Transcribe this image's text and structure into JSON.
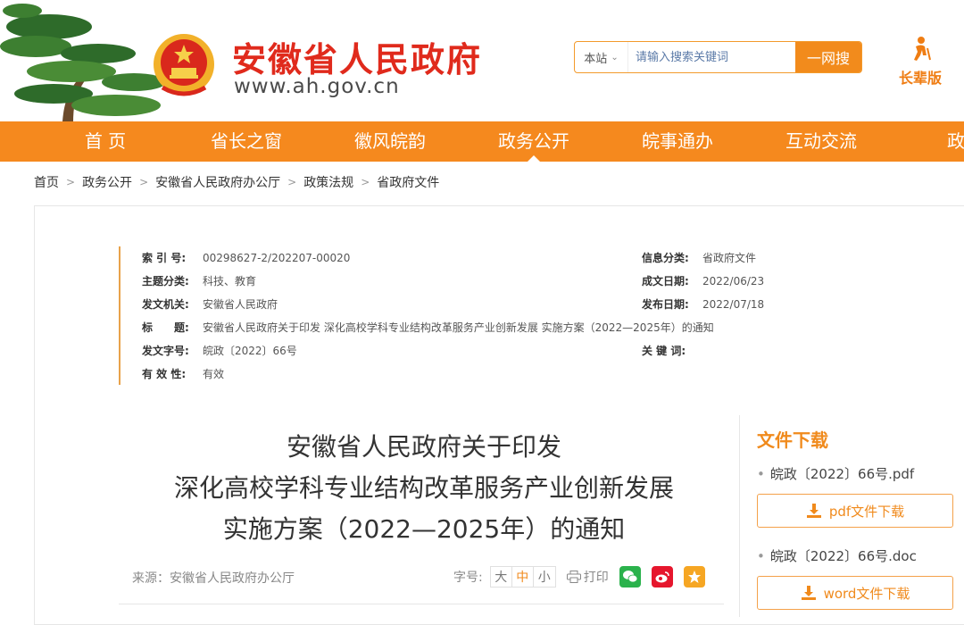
{
  "header": {
    "site_title": "安徽省人民政府",
    "site_url": "www.ah.gov.cn",
    "search": {
      "scope": "本站",
      "placeholder": "请输入搜索关键词",
      "button": "一网搜"
    },
    "elder_mode": "长辈版"
  },
  "nav": {
    "items": [
      {
        "label": "首 页",
        "active": false
      },
      {
        "label": "省长之窗",
        "active": false
      },
      {
        "label": "徽风皖韵",
        "active": false
      },
      {
        "label": "政务公开",
        "active": true
      },
      {
        "label": "皖事通办",
        "active": false
      },
      {
        "label": "互动交流",
        "active": false
      },
      {
        "label": "政府",
        "active": false
      }
    ]
  },
  "breadcrumb": [
    "首页",
    "政务公开",
    "安徽省人民政府办公厅",
    "政策法规",
    "省政府文件"
  ],
  "meta": {
    "index_no": {
      "k": "索 引 号:",
      "v": "00298627-2/202207-00020"
    },
    "topic": {
      "k": "主题分类:",
      "v": "科技、教育"
    },
    "issuer": {
      "k": "发文机关:",
      "v": "安徽省人民政府"
    },
    "title": {
      "k": "标　　题:",
      "v": "安徽省人民政府关于印发 深化高校学科专业结构改革服务产业创新发展 实施方案（2022—2025年）的通知"
    },
    "doc_no": {
      "k": "发文字号:",
      "v": "皖政〔2022〕66号"
    },
    "validity": {
      "k": "有 效 性:",
      "v": "有效"
    },
    "info_class": {
      "k": "信息分类:",
      "v": "省政府文件"
    },
    "made_date": {
      "k": "成文日期:",
      "v": "2022/06/23"
    },
    "pub_date": {
      "k": "发布日期:",
      "v": "2022/07/18"
    },
    "keywords": {
      "k": "关 键 词:",
      "v": ""
    }
  },
  "doc": {
    "title_lines": [
      "安徽省人民政府关于印发",
      "深化高校学科专业结构改革服务产业创新发展",
      "实施方案（2022—2025年）的通知"
    ],
    "source": "来源：安徽省人民政府办公厅",
    "font_size_label": "字号:",
    "font_sizes": [
      "大",
      "中",
      "小"
    ],
    "print": "打印"
  },
  "download": {
    "title": "文件下载",
    "files": [
      {
        "name": "皖政〔2022〕66号.pdf",
        "button": "pdf文件下载"
      },
      {
        "name": "皖政〔2022〕66号.doc",
        "button": "word文件下载"
      }
    ]
  },
  "colors": {
    "accent": "#f5891e",
    "brand_red": "#e02a1c",
    "wechat": "#2bb24c",
    "weibo": "#e6162d",
    "star": "#f6a623"
  }
}
